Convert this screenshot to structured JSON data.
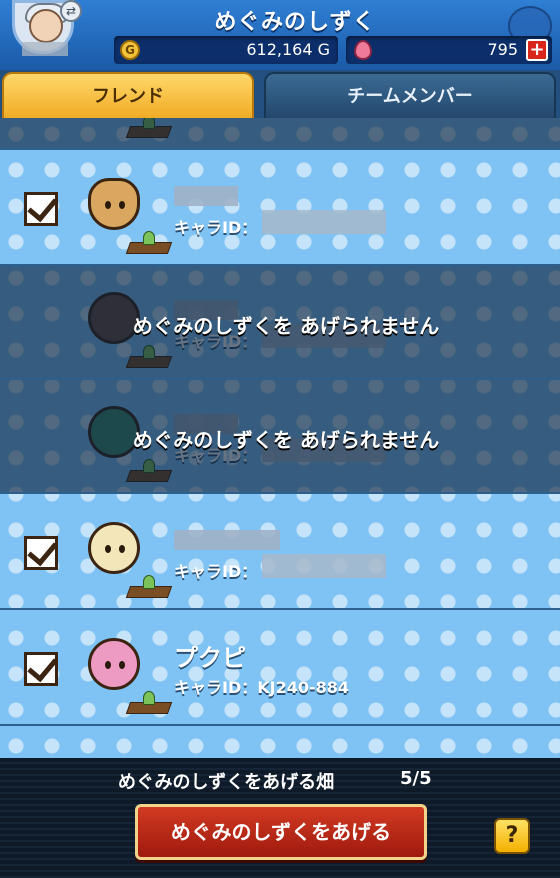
{
  "header": {
    "title": "めぐみのしずく",
    "gold": "612,164 G",
    "gold_icon": "G",
    "gems": "795",
    "plus_label": "+"
  },
  "tabs": [
    {
      "label": "フレンド",
      "active": true
    },
    {
      "label": "チームメンバー",
      "active": false
    }
  ],
  "rows": [
    {
      "checked": true,
      "disabled": false,
      "name": "",
      "chara_label": "キャラID：",
      "chara_id": ""
    },
    {
      "checked": false,
      "disabled": true,
      "message": "めぐみのしずくを あげられません",
      "chara_label": "キャラID："
    },
    {
      "checked": false,
      "disabled": true,
      "message": "めぐみのしずくを あげられません",
      "chara_label": "キャラID："
    },
    {
      "checked": true,
      "disabled": false,
      "name": "",
      "chara_label": "キャラID：",
      "chara_id": ""
    },
    {
      "checked": true,
      "disabled": false,
      "name": "プクピ",
      "chara_label": "キャラID：KJ240-884",
      "chara_id": "KJ240-884"
    }
  ],
  "footer": {
    "quota_label": "めぐみのしずくをあげる畑",
    "quota_value": "5/5",
    "give_button": "めぐみのしずくをあげる",
    "help_button": "?"
  }
}
